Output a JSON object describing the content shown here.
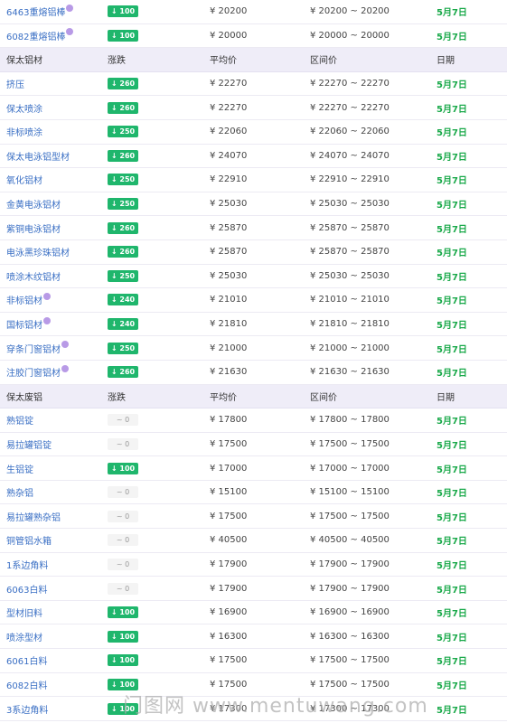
{
  "colors": {
    "header_bg": "#efedf8",
    "up_badge": "#1fb66c",
    "date_green": "#1aa94a",
    "name_blue": "#3a6fc4"
  },
  "sections": [
    {
      "header": null,
      "rows": [
        {
          "name": "6463重熔铝棒",
          "hot": true,
          "change": "↓ 100",
          "dir": "up",
          "avg": "¥ 20200",
          "range": "¥ 20200 ~ 20200",
          "date": "5月7日"
        },
        {
          "name": "6082重熔铝棒",
          "hot": true,
          "change": "↓ 100",
          "dir": "up",
          "avg": "¥ 20000",
          "range": "¥ 20000 ~ 20000",
          "date": "5月7日"
        }
      ]
    },
    {
      "header": {
        "name": "保太铝材",
        "change": "涨跌",
        "avg": "平均价",
        "range": "区间价",
        "date": "日期"
      },
      "rows": [
        {
          "name": "挤压",
          "hot": false,
          "change": "↓ 260",
          "dir": "up",
          "avg": "¥ 22270",
          "range": "¥ 22270 ~ 22270",
          "date": "5月7日"
        },
        {
          "name": "保太喷涂",
          "hot": false,
          "change": "↓ 260",
          "dir": "up",
          "avg": "¥ 22270",
          "range": "¥ 22270 ~ 22270",
          "date": "5月7日"
        },
        {
          "name": "非标喷涂",
          "hot": false,
          "change": "↓ 250",
          "dir": "up",
          "avg": "¥ 22060",
          "range": "¥ 22060 ~ 22060",
          "date": "5月7日"
        },
        {
          "name": "保太电泳铝型材",
          "hot": false,
          "change": "↓ 260",
          "dir": "up",
          "avg": "¥ 24070",
          "range": "¥ 24070 ~ 24070",
          "date": "5月7日"
        },
        {
          "name": "氧化铝材",
          "hot": false,
          "change": "↓ 250",
          "dir": "up",
          "avg": "¥ 22910",
          "range": "¥ 22910 ~ 22910",
          "date": "5月7日"
        },
        {
          "name": "金黄电泳铝材",
          "hot": false,
          "change": "↓ 250",
          "dir": "up",
          "avg": "¥ 25030",
          "range": "¥ 25030 ~ 25030",
          "date": "5月7日"
        },
        {
          "name": "紫铜电泳铝材",
          "hot": false,
          "change": "↓ 260",
          "dir": "up",
          "avg": "¥ 25870",
          "range": "¥ 25870 ~ 25870",
          "date": "5月7日"
        },
        {
          "name": "电泳黑珍珠铝材",
          "hot": false,
          "change": "↓ 260",
          "dir": "up",
          "avg": "¥ 25870",
          "range": "¥ 25870 ~ 25870",
          "date": "5月7日"
        },
        {
          "name": "喷涂木纹铝材",
          "hot": false,
          "change": "↓ 250",
          "dir": "up",
          "avg": "¥ 25030",
          "range": "¥ 25030 ~ 25030",
          "date": "5月7日"
        },
        {
          "name": "非标铝材",
          "hot": true,
          "change": "↓ 240",
          "dir": "up",
          "avg": "¥ 21010",
          "range": "¥ 21010 ~ 21010",
          "date": "5月7日"
        },
        {
          "name": "国标铝材",
          "hot": true,
          "change": "↓ 240",
          "dir": "up",
          "avg": "¥ 21810",
          "range": "¥ 21810 ~ 21810",
          "date": "5月7日"
        },
        {
          "name": "穿条门窗铝材",
          "hot": true,
          "change": "↓ 250",
          "dir": "up",
          "avg": "¥ 21000",
          "range": "¥ 21000 ~ 21000",
          "date": "5月7日"
        },
        {
          "name": "注胶门窗铝材",
          "hot": true,
          "change": "↓ 260",
          "dir": "up",
          "avg": "¥ 21630",
          "range": "¥ 21630 ~ 21630",
          "date": "5月7日"
        }
      ]
    },
    {
      "header": {
        "name": "保太废铝",
        "change": "涨跌",
        "avg": "平均价",
        "range": "区间价",
        "date": "日期"
      },
      "rows": [
        {
          "name": "熟铝锭",
          "hot": false,
          "change": "~ 0",
          "dir": "flat",
          "avg": "¥ 17800",
          "range": "¥ 17800 ~ 17800",
          "date": "5月7日"
        },
        {
          "name": "易拉罐铝锭",
          "hot": false,
          "change": "~ 0",
          "dir": "flat",
          "avg": "¥ 17500",
          "range": "¥ 17500 ~ 17500",
          "date": "5月7日"
        },
        {
          "name": "生铝锭",
          "hot": false,
          "change": "↓ 100",
          "dir": "up",
          "avg": "¥ 17000",
          "range": "¥ 17000 ~ 17000",
          "date": "5月7日"
        },
        {
          "name": "熟杂铝",
          "hot": false,
          "change": "~ 0",
          "dir": "flat",
          "avg": "¥ 15100",
          "range": "¥ 15100 ~ 15100",
          "date": "5月7日"
        },
        {
          "name": "易拉罐熟杂铝",
          "hot": false,
          "change": "~ 0",
          "dir": "flat",
          "avg": "¥ 17500",
          "range": "¥ 17500 ~ 17500",
          "date": "5月7日"
        },
        {
          "name": "铜管铝水箱",
          "hot": false,
          "change": "~ 0",
          "dir": "flat",
          "avg": "¥ 40500",
          "range": "¥ 40500 ~ 40500",
          "date": "5月7日"
        },
        {
          "name": "1系边角料",
          "hot": false,
          "change": "~ 0",
          "dir": "flat",
          "avg": "¥ 17900",
          "range": "¥ 17900 ~ 17900",
          "date": "5月7日"
        },
        {
          "name": "6063白料",
          "hot": false,
          "change": "~ 0",
          "dir": "flat",
          "avg": "¥ 17900",
          "range": "¥ 17900 ~ 17900",
          "date": "5月7日"
        },
        {
          "name": "型材旧料",
          "hot": false,
          "change": "↓ 100",
          "dir": "up",
          "avg": "¥ 16900",
          "range": "¥ 16900 ~ 16900",
          "date": "5月7日"
        },
        {
          "name": "喷涂型材",
          "hot": false,
          "change": "↓ 100",
          "dir": "up",
          "avg": "¥ 16300",
          "range": "¥ 16300 ~ 16300",
          "date": "5月7日"
        },
        {
          "name": "6061白料",
          "hot": false,
          "change": "↓ 100",
          "dir": "up",
          "avg": "¥ 17500",
          "range": "¥ 17500 ~ 17500",
          "date": "5月7日"
        },
        {
          "name": "6082白料",
          "hot": false,
          "change": "↓ 100",
          "dir": "up",
          "avg": "¥ 17500",
          "range": "¥ 17500 ~ 17500",
          "date": "5月7日"
        },
        {
          "name": "3系边角料",
          "hot": false,
          "change": "↓ 100",
          "dir": "up",
          "avg": "¥ 17300",
          "range": "¥ 17300 ~ 17300",
          "date": "5月7日"
        }
      ]
    }
  ],
  "watermark": "门图网 www.mentuwang.com"
}
